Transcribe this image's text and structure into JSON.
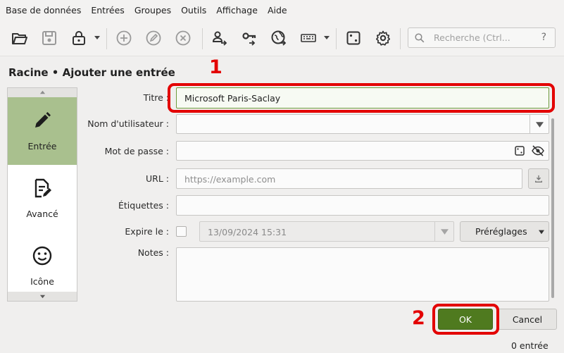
{
  "menu": [
    "Base de données",
    "Entrées",
    "Groupes",
    "Outils",
    "Affichage",
    "Aide"
  ],
  "toolbar": {
    "icons": [
      "open-database-icon",
      "save-database-icon",
      "lock-database-icon",
      "add-entry-icon",
      "edit-entry-icon",
      "delete-entry-icon",
      "copy-username-icon",
      "copy-password-icon",
      "copy-url-icon",
      "autotype-keyboard-icon",
      "password-generator-icon",
      "settings-gear-icon"
    ],
    "search_placeholder": "Recherche (Ctrl...",
    "search_help": "?"
  },
  "page_title": "Racine • Ajouter une entrée",
  "sidebar": {
    "items": [
      {
        "label": "Entrée",
        "icon": "pencil-icon",
        "active": true
      },
      {
        "label": "Avancé",
        "icon": "document-edit-icon",
        "active": false
      },
      {
        "label": "Icône",
        "icon": "smiley-icon",
        "active": false
      }
    ]
  },
  "form": {
    "title_label": "Titre :",
    "title_value": "Microsoft Paris-Saclay",
    "username_label": "Nom d'utilisateur :",
    "username_value": "",
    "password_label": "Mot de passe :",
    "password_value": "",
    "url_label": "URL :",
    "url_placeholder": "https://example.com",
    "tags_label": "Étiquettes :",
    "tags_value": "",
    "expires_label": "Expire le :",
    "expires_checked": false,
    "expires_value": "13/09/2024 15:31",
    "presets_label": "Préréglages",
    "notes_label": "Notes :",
    "notes_value": ""
  },
  "buttons": {
    "ok": "OK",
    "cancel": "Cancel"
  },
  "status": {
    "entries": "0 entrée"
  },
  "annotations": {
    "one": "1",
    "two": "2"
  },
  "colors": {
    "accent_green": "#4f7a1f",
    "active_sidebar": "#a9c08e",
    "annotation_red": "#e30000"
  }
}
